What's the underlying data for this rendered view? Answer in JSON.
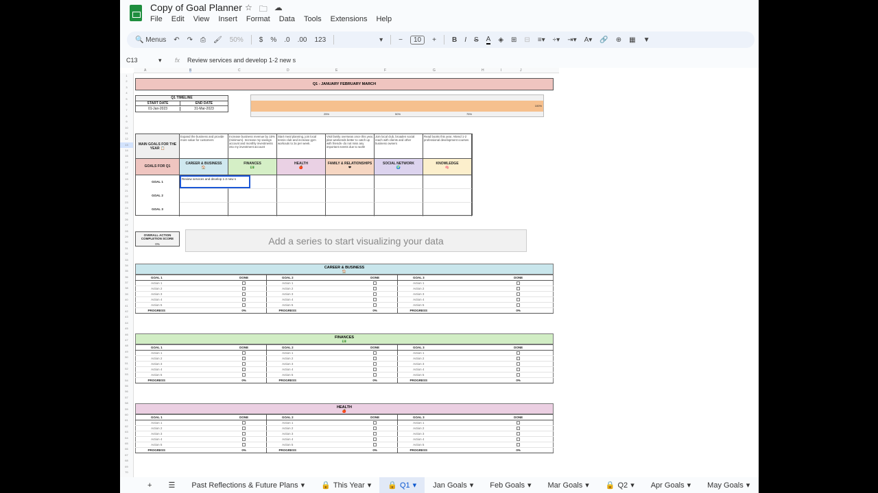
{
  "app": {
    "title": "Copy of Goal Planner",
    "menu": [
      "File",
      "Edit",
      "View",
      "Insert",
      "Format",
      "Data",
      "Tools",
      "Extensions",
      "Help"
    ]
  },
  "toolbar": {
    "search": "Menus",
    "zoom": "50%",
    "currency": "$",
    "percent": "%",
    "dec_dec": ".0",
    "dec_inc": ".00",
    "format": "123",
    "font_size": "10",
    "minus": "−",
    "plus": "+",
    "bold": "B",
    "italic": "I"
  },
  "formula_bar": {
    "cell_ref": "C13",
    "fx": "fx",
    "content": "Review services and develop 1-2 new s"
  },
  "column_letters": [
    "A",
    "B",
    "C",
    "D",
    "E",
    "F",
    "G",
    "H",
    "I",
    "J"
  ],
  "sheet": {
    "banner": "Q1 - JANUARY FEBRUARY MARCH",
    "timeline": {
      "title": "Q1 TIMELINE",
      "start_label": "START DATE",
      "end_label": "END DATE",
      "start": "01-Jan-2023",
      "end": "31-Mar-2023"
    },
    "timeline_chart": {
      "progress_percent": 100,
      "value_label": "100%",
      "ticks": [
        "25%",
        "50%",
        "75%"
      ],
      "bar_color": "#f6c08e"
    },
    "main_goals_label": "MAIN GOALS FOR THE YEAR 📋",
    "main_goals": [
      "Expand the business and provide more value for customers",
      "Increase business revenue by 15% (minimum). Increase my savings account and monthly investments into my investment account",
      "Start meal planning, join local tennis club and increase gym workouts to 3x per week.",
      "Visit family overseas once this year, plan weekends better to catch up with friends- do not miss any important events due to work!",
      "Join local club, broaden social reach with clients and other business owners",
      "Read books this year. Attend 1-2 professional development courses"
    ],
    "goals_for_label": "GOALS FOR Q1",
    "categories": [
      {
        "name": "CAREER & BUSINESS",
        "icon": "🏠",
        "color": "#cfe8ef"
      },
      {
        "name": "FINANCES",
        "icon": "💵",
        "color": "#d5efc6"
      },
      {
        "name": "HEALTH",
        "icon": "🍎",
        "color": "#ead1e4"
      },
      {
        "name": "FAMILY & RELATIONSHIPS",
        "icon": "❤",
        "color": "#f6d6c2"
      },
      {
        "name": "SOCIAL NETWORK",
        "icon": "🌍",
        "color": "#dcd3ee"
      },
      {
        "name": "KNOWLEDGE",
        "icon": "🧠",
        "color": "#fcefcc"
      }
    ],
    "goal_rows": [
      "GOAL 1",
      "GOAL 2",
      "GOAL 3"
    ],
    "selected_cell_text": "Review services and develop 1-2 new s",
    "score": {
      "label": "OVERALL ACTION COMPLETION SCORE",
      "value": "0%"
    },
    "chart_placeholder": "Add a series to start visualizing your data",
    "sections": [
      {
        "title": "CAREER & BUSINESS",
        "icon": "🏠",
        "color": "#c9e6ec"
      },
      {
        "title": "FINANCES",
        "icon": "💵",
        "color": "#d1edc4"
      },
      {
        "title": "HEALTH",
        "icon": "🍎",
        "color": "#ebcfe2"
      }
    ],
    "section_goals": [
      "GOAL 1",
      "GOAL 2",
      "GOAL 3"
    ],
    "done_label": "DONE",
    "actions": [
      "Action 1",
      "Action 2",
      "Action 3",
      "Action 4",
      "Action 5"
    ],
    "progress_label": "PROGRESS",
    "progress_value": "0%"
  },
  "tabs": [
    {
      "label": "Past Reflections & Future Plans"
    },
    {
      "label": "This Year",
      "locked": true
    },
    {
      "label": "Q1",
      "locked": true,
      "active": true
    },
    {
      "label": "Jan Goals"
    },
    {
      "label": "Feb Goals"
    },
    {
      "label": "Mar Goals"
    },
    {
      "label": "Q2",
      "locked": true
    },
    {
      "label": "Apr Goals"
    },
    {
      "label": "May Goals"
    }
  ]
}
